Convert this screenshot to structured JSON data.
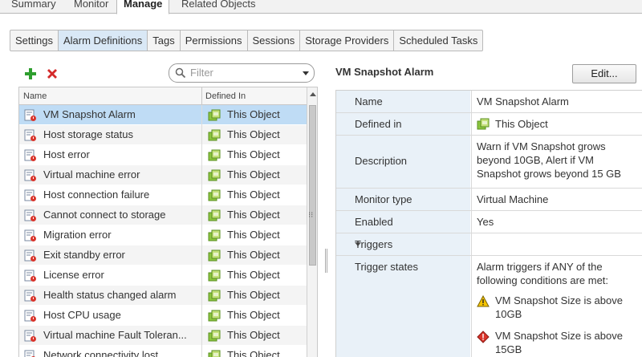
{
  "top_tabs": [
    "Summary",
    "Monitor",
    "Manage",
    "Related Objects"
  ],
  "sub_tabs": [
    "Settings",
    "Alarm Definitions",
    "Tags",
    "Permissions",
    "Sessions",
    "Storage Providers",
    "Scheduled Tasks"
  ],
  "filter": {
    "placeholder": "Filter"
  },
  "grid": {
    "headers": {
      "name": "Name",
      "defined_in": "Defined In"
    },
    "rows": [
      {
        "name": "VM Snapshot Alarm",
        "defined_in": "This Object"
      },
      {
        "name": "Host storage status",
        "defined_in": "This Object"
      },
      {
        "name": "Host error",
        "defined_in": "This Object"
      },
      {
        "name": "Virtual machine error",
        "defined_in": "This Object"
      },
      {
        "name": "Host connection failure",
        "defined_in": "This Object"
      },
      {
        "name": "Cannot connect to storage",
        "defined_in": "This Object"
      },
      {
        "name": "Migration error",
        "defined_in": "This Object"
      },
      {
        "name": "Exit standby error",
        "defined_in": "This Object"
      },
      {
        "name": "License error",
        "defined_in": "This Object"
      },
      {
        "name": "Health status changed alarm",
        "defined_in": "This Object"
      },
      {
        "name": "Host CPU usage",
        "defined_in": "This Object"
      },
      {
        "name": "Virtual machine Fault Toleran...",
        "defined_in": "This Object"
      },
      {
        "name": "Network connectivity lost",
        "defined_in": "This Object"
      }
    ]
  },
  "details": {
    "title": "VM Snapshot Alarm",
    "edit_label": "Edit...",
    "name_label": "Name",
    "name_value": "VM Snapshot Alarm",
    "defined_in_label": "Defined in",
    "defined_in_value": "This Object",
    "description_label": "Description",
    "description_lines": [
      "Warn if VM Snapshot grows",
      "beyond 10GB, Alert if VM",
      "Snapshot grows beyond 15 GB"
    ],
    "monitor_type_label": "Monitor type",
    "monitor_type_value": "Virtual Machine",
    "enabled_label": "Enabled",
    "enabled_value": "Yes",
    "triggers_label": "Triggers",
    "trigger_states_label": "Trigger states",
    "trigger_states_lines": [
      "Alarm triggers if ANY of the",
      "following conditions are met:"
    ],
    "conditions": [
      {
        "icon": "warning-icon",
        "lines": [
          "VM Snapshot Size is above",
          "10GB"
        ]
      },
      {
        "icon": "alert-icon",
        "lines": [
          "VM Snapshot Size is above",
          "15GB"
        ]
      }
    ]
  },
  "colors": {
    "selected_row": "#bfdcf5",
    "label_bg": "#e9f1f8",
    "active_subtab": "#d9e8f6",
    "add_green": "#2e9e2e",
    "delete_red": "#d42a2a"
  }
}
